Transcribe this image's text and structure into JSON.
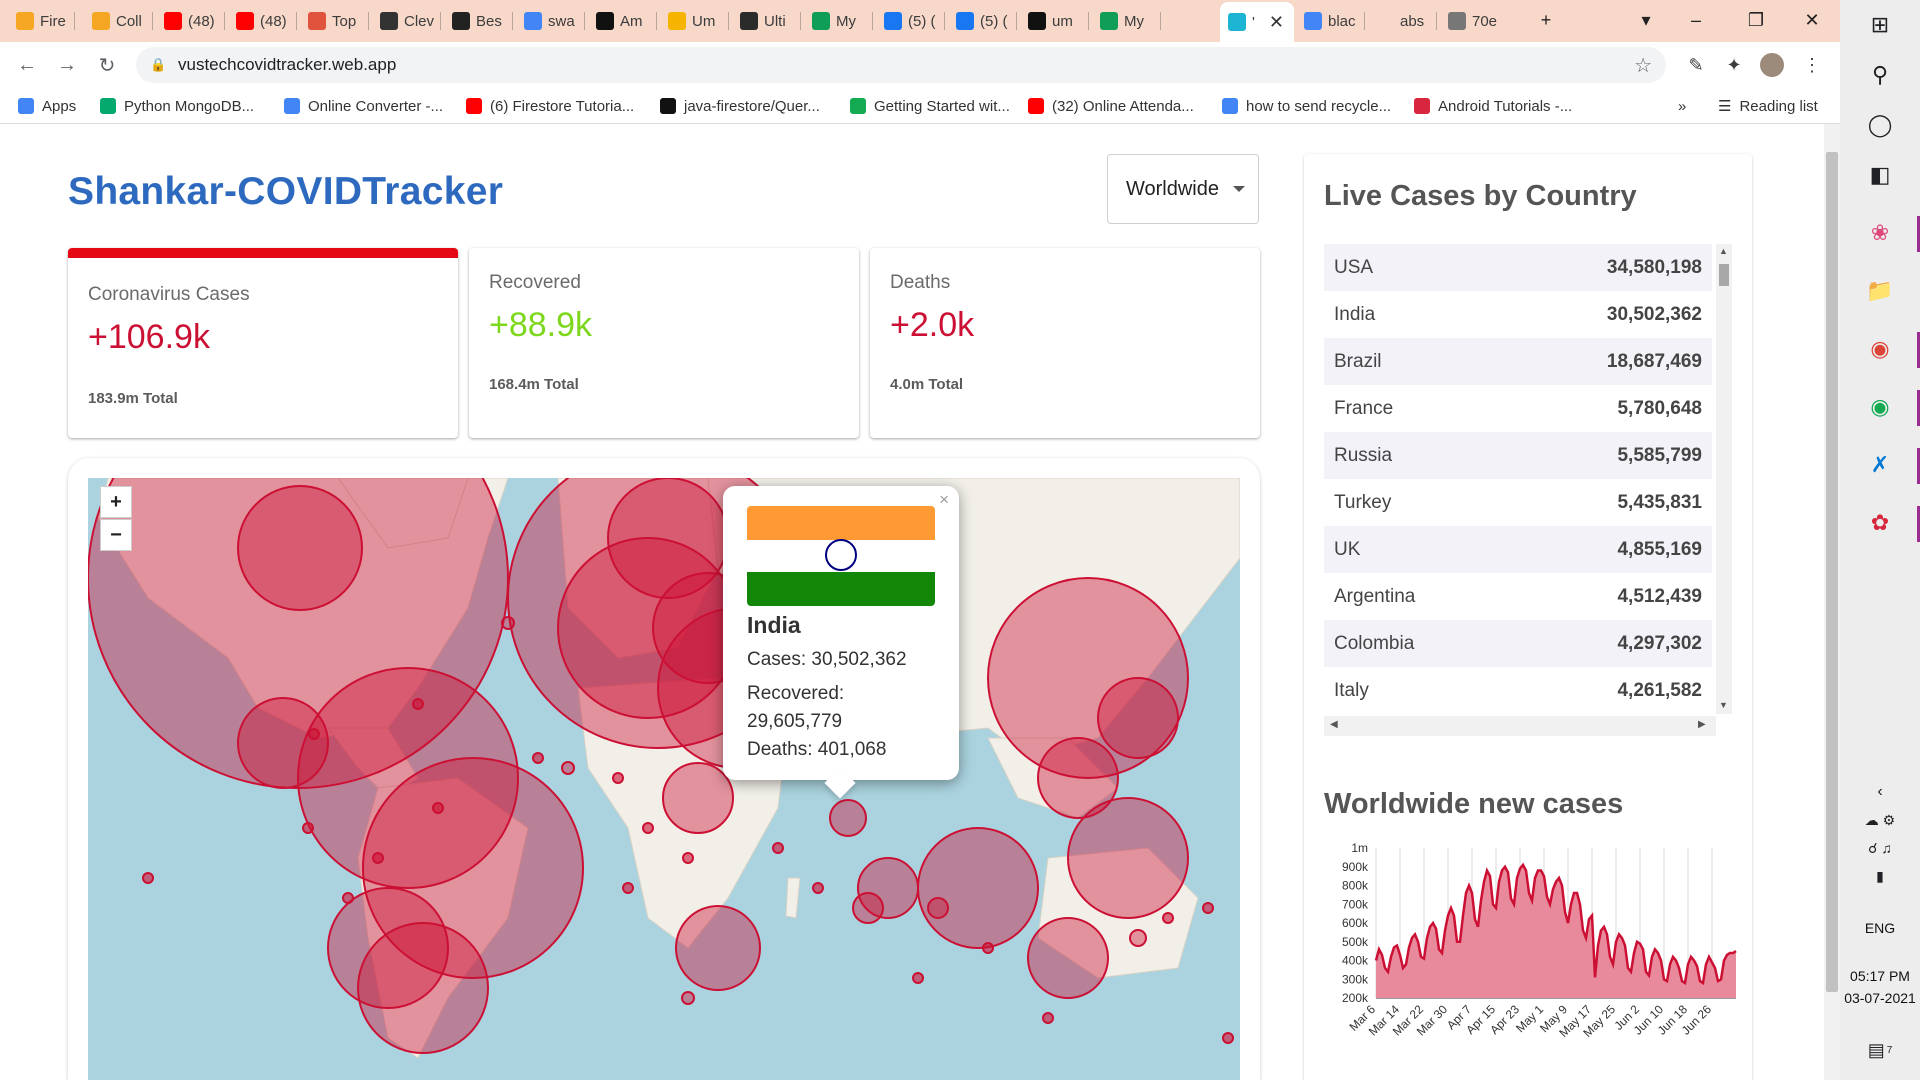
{
  "browser": {
    "tabs": [
      {
        "label": "Fire",
        "icon": "firebase-icon",
        "color": "#f5a623"
      },
      {
        "label": "Coll",
        "icon": "firebase-icon",
        "color": "#f5a623"
      },
      {
        "label": "(48)",
        "icon": "youtube-icon",
        "color": "#ff0000"
      },
      {
        "label": "(48)",
        "icon": "youtube-icon",
        "color": "#ff0000"
      },
      {
        "label": "Top",
        "icon": "webflow-icon",
        "color": "#e0533d"
      },
      {
        "label": "Clev",
        "icon": "cleverprogrammer-icon",
        "color": "#333333"
      },
      {
        "label": "Bes",
        "icon": "jf-icon",
        "color": "#222222"
      },
      {
        "label": "swa",
        "icon": "google-icon",
        "color": "#4285f4"
      },
      {
        "label": "Am",
        "icon": "amazon-icon",
        "color": "#111111"
      },
      {
        "label": "Um",
        "icon": "udemy-icon",
        "color": "#f4b400"
      },
      {
        "label": "Ulti",
        "icon": "ultimate-icon",
        "color": "#2b2b2b"
      },
      {
        "label": "My",
        "icon": "google-drive-icon",
        "color": "#0f9d58"
      },
      {
        "label": "(5) (",
        "icon": "facebook-icon",
        "color": "#1877f2"
      },
      {
        "label": "(5) (",
        "icon": "facebook-icon",
        "color": "#1877f2"
      },
      {
        "label": "um",
        "icon": "github-icon",
        "color": "#111111"
      },
      {
        "label": "My",
        "icon": "google-drive-icon",
        "color": "#0f9d58"
      },
      {
        "label": "'",
        "icon": "react-icon",
        "color": "#1eb4d4",
        "active": true
      },
      {
        "label": "blac",
        "icon": "google-icon",
        "color": "#4285f4"
      },
      {
        "label": "abs",
        "icon": "blank-icon",
        "color": "#f7d8c9"
      },
      {
        "label": "70e",
        "icon": "globe-icon",
        "color": "#777777"
      }
    ],
    "url": "vustechcovidtracker.web.app",
    "bookmarks": [
      {
        "label": "Apps",
        "icon": "apps-grid-icon",
        "color": "#4285f4"
      },
      {
        "label": "Python MongoDB...",
        "icon": "w3schools-icon",
        "color": "#04aa6d"
      },
      {
        "label": "Online Converter -...",
        "icon": "converter-icon",
        "color": "#4285f4"
      },
      {
        "label": "(6) Firestore Tutoria...",
        "icon": "youtube-icon",
        "color": "#ff0000"
      },
      {
        "label": "java-firestore/Quer...",
        "icon": "github-icon",
        "color": "#111111"
      },
      {
        "label": "Getting Started wit...",
        "icon": "mongodb-leaf-icon",
        "color": "#13aa52"
      },
      {
        "label": "(32) Online Attenda...",
        "icon": "youtube-icon",
        "color": "#ff0000"
      },
      {
        "label": "how to send recycle...",
        "icon": "google-icon",
        "color": "#4285f4"
      },
      {
        "label": "Android Tutorials -...",
        "icon": "tutorial-icon",
        "color": "#d7263d"
      }
    ],
    "reading_list": "Reading list"
  },
  "app": {
    "title": "Shankar-COVIDTracker",
    "country": "Worldwide"
  },
  "stats": [
    {
      "label": "Coronavirus Cases",
      "value": "+106.9k",
      "total": "183.9m Total",
      "color": "#cc1034",
      "selected": true
    },
    {
      "label": "Recovered",
      "value": "+88.9k",
      "total": "168.4m Total",
      "color": "#7dd71d",
      "selected": false
    },
    {
      "label": "Deaths",
      "value": "+2.0k",
      "total": "4.0m Total",
      "color": "#cc1034",
      "selected": false
    }
  ],
  "map": {
    "zoom_in": "+",
    "zoom_out": "−",
    "circle_color": "#cc1034",
    "popup": {
      "name": "India",
      "cases_label": "Cases:",
      "cases": "30,502,362",
      "recovered_label": "Recovered:",
      "recovered": "29,605,779",
      "deaths_label": "Deaths:",
      "deaths": "401,068",
      "close": "×"
    }
  },
  "live_cases": {
    "title": "Live Cases by Country",
    "rows": [
      {
        "country": "USA",
        "cases": "34,580,198"
      },
      {
        "country": "India",
        "cases": "30,502,362"
      },
      {
        "country": "Brazil",
        "cases": "18,687,469"
      },
      {
        "country": "France",
        "cases": "5,780,648"
      },
      {
        "country": "Russia",
        "cases": "5,585,799"
      },
      {
        "country": "Turkey",
        "cases": "5,435,831"
      },
      {
        "country": "UK",
        "cases": "4,855,169"
      },
      {
        "country": "Argentina",
        "cases": "4,512,439"
      },
      {
        "country": "Colombia",
        "cases": "4,297,302"
      },
      {
        "country": "Italy",
        "cases": "4,261,582"
      }
    ]
  },
  "chart_data": {
    "type": "area",
    "title": "Worldwide new cases",
    "xlabel": "",
    "ylabel": "",
    "ylim": [
      200000,
      1000000
    ],
    "y_ticks": [
      "200k",
      "300k",
      "400k",
      "500k",
      "600k",
      "700k",
      "800k",
      "900k",
      "1m"
    ],
    "x_ticks": [
      "Mar 6",
      "Mar 14",
      "Mar 22",
      "Mar 30",
      "Apr 7",
      "Apr 15",
      "Apr 23",
      "May 1",
      "May 9",
      "May 17",
      "May 25",
      "Jun 2",
      "Jun 10",
      "Jun 18",
      "Jun 26"
    ],
    "x": [
      "Mar 6",
      "Mar 7",
      "Mar 8",
      "Mar 9",
      "Mar 10",
      "Mar 11",
      "Mar 12",
      "Mar 13",
      "Mar 14",
      "Mar 15",
      "Mar 16",
      "Mar 17",
      "Mar 18",
      "Mar 19",
      "Mar 20",
      "Mar 21",
      "Mar 22",
      "Mar 23",
      "Mar 24",
      "Mar 25",
      "Mar 26",
      "Mar 27",
      "Mar 28",
      "Mar 29",
      "Mar 30",
      "Mar 31",
      "Apr 1",
      "Apr 2",
      "Apr 3",
      "Apr 4",
      "Apr 5",
      "Apr 6",
      "Apr 7",
      "Apr 8",
      "Apr 9",
      "Apr 10",
      "Apr 11",
      "Apr 12",
      "Apr 13",
      "Apr 14",
      "Apr 15",
      "Apr 16",
      "Apr 17",
      "Apr 18",
      "Apr 19",
      "Apr 20",
      "Apr 21",
      "Apr 22",
      "Apr 23",
      "Apr 24",
      "Apr 25",
      "Apr 26",
      "Apr 27",
      "Apr 28",
      "Apr 29",
      "Apr 30",
      "May 1",
      "May 2",
      "May 3",
      "May 4",
      "May 5",
      "May 6",
      "May 7",
      "May 8",
      "May 9",
      "May 10",
      "May 11",
      "May 12",
      "May 13",
      "May 14",
      "May 15",
      "May 16",
      "May 17",
      "May 18",
      "May 19",
      "May 20",
      "May 21",
      "May 22",
      "May 23",
      "May 24",
      "May 25",
      "May 26",
      "May 27",
      "May 28",
      "May 29",
      "May 30",
      "May 31",
      "Jun 1",
      "Jun 2",
      "Jun 3",
      "Jun 4",
      "Jun 5",
      "Jun 6",
      "Jun 7",
      "Jun 8",
      "Jun 9",
      "Jun 10",
      "Jun 11",
      "Jun 12",
      "Jun 13",
      "Jun 14",
      "Jun 15",
      "Jun 16",
      "Jun 17",
      "Jun 18",
      "Jun 19",
      "Jun 20",
      "Jun 21",
      "Jun 22",
      "Jun 23",
      "Jun 24",
      "Jun 25",
      "Jun 26",
      "Jun 27",
      "Jun 28",
      "Jun 29",
      "Jun 30",
      "Jul 1",
      "Jul 2"
    ],
    "series": [
      {
        "values": [
          400000,
          460000,
          430000,
          360000,
          340000,
          420000,
          470000,
          480000,
          430000,
          360000,
          380000,
          470000,
          520000,
          540000,
          500000,
          420000,
          410000,
          520000,
          580000,
          600000,
          570000,
          460000,
          440000,
          560000,
          640000,
          680000,
          640000,
          500000,
          500000,
          640000,
          760000,
          800000,
          760000,
          620000,
          580000,
          720000,
          820000,
          880000,
          850000,
          700000,
          680000,
          820000,
          880000,
          900000,
          870000,
          730000,
          700000,
          840000,
          890000,
          910000,
          880000,
          760000,
          720000,
          840000,
          880000,
          880000,
          850000,
          740000,
          700000,
          780000,
          820000,
          840000,
          800000,
          660000,
          600000,
          700000,
          760000,
          760000,
          700000,
          560000,
          520000,
          620000,
          640000,
          310000,
          480000,
          560000,
          580000,
          540000,
          420000,
          380000,
          500000,
          540000,
          520000,
          480000,
          360000,
          340000,
          440000,
          500000,
          490000,
          460000,
          340000,
          320000,
          420000,
          460000,
          440000,
          400000,
          300000,
          290000,
          380000,
          420000,
          400000,
          360000,
          290000,
          280000,
          380000,
          420000,
          400000,
          370000,
          290000,
          280000,
          380000,
          420000,
          390000,
          360000,
          290000,
          300000,
          400000,
          430000,
          440000,
          440000,
          450000
        ]
      }
    ],
    "fill": "#e88a9c",
    "stroke": "#cc1034"
  },
  "system": {
    "language": "ENG",
    "time": "05:17 PM",
    "date": "03-07-2021",
    "notifications": "7"
  }
}
